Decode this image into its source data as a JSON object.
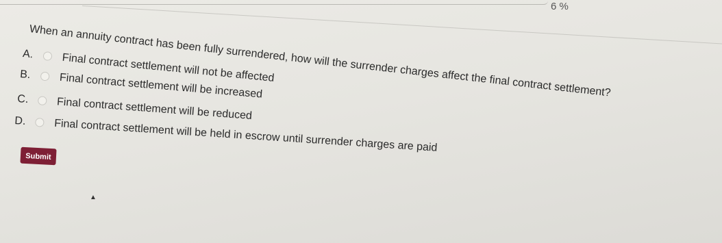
{
  "progress": {
    "label": "6 %"
  },
  "question": {
    "text": "When an annuity contract has been fully surrendered, how will the surrender charges affect the final contract settlement?"
  },
  "options": [
    {
      "letter": "A.",
      "text": "Final contract settlement will not be affected"
    },
    {
      "letter": "B.",
      "text": "Final contract settlement will be increased"
    },
    {
      "letter": "C.",
      "text": "Final contract settlement will be reduced"
    },
    {
      "letter": "D.",
      "text": "Final contract settlement will be held in escrow until surrender charges are paid"
    }
  ],
  "submit": {
    "label": "Submit"
  },
  "colors": {
    "submit_bg": "#7e1f35",
    "background": "#e6e5e0",
    "text": "#2b2b2b"
  }
}
